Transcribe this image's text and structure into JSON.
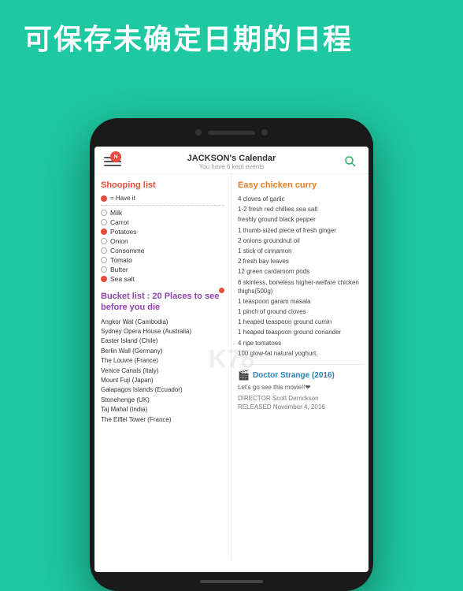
{
  "hero": {
    "text": "可保存未确定日期的日程"
  },
  "phone": {
    "header": {
      "title": "JACKSON's Calendar",
      "subtitle": "You have 6 kept events",
      "notification": "N"
    }
  },
  "left_column": {
    "shopping_section": {
      "title": "Shooping list",
      "legend": "= Have it",
      "items": [
        {
          "name": "Milk",
          "dot": "empty"
        },
        {
          "name": "Carrot",
          "dot": "empty"
        },
        {
          "name": "Potatoes",
          "dot": "red"
        },
        {
          "name": "Onion",
          "dot": "empty"
        },
        {
          "name": "Consomme",
          "dot": "empty"
        },
        {
          "name": "Tomato",
          "dot": "empty"
        },
        {
          "name": "Butter",
          "dot": "empty"
        },
        {
          "name": "Sea salt",
          "dot": "red"
        }
      ]
    },
    "bucket_section": {
      "title": "Bucket list : 20 Places to see before you die",
      "items": [
        "Angkor Wat (Cambodia)",
        "Sydney Opera House (Australia)",
        "Easter Island (Chile)",
        "Berlin Wall (Germany)",
        "The Louvre (France)",
        "Venice Canals (Italy)",
        "Mount Fuji (Japan)",
        "Galapagos Islands (Ecuador)",
        "Stonehenge (UK)",
        "Taj Mahal (India)",
        "The Eiffel Tower (France)"
      ]
    }
  },
  "right_column": {
    "curry_section": {
      "title": "Easy chicken curry",
      "ingredients": [
        "4 cloves of garlic",
        "1-2 fresh red chillies sea salt",
        "freshly ground black pepper",
        "1 thumb-sized piece of fresh ginger",
        "2 onions groundnut oil",
        "1 stick of cinnamon",
        "2 fresh bay leaves",
        "12 green cardamom pods",
        "6 skinless, boneless higher-welfare chicken thighs(500g)",
        "1 teaspoon garam masala",
        "1 pinch of ground cloves",
        "1 heaped teaspoon ground cumin",
        "1 heaped teaspoon ground coriander",
        "4 ripe tomatoes",
        "100  glow-fat natural yoghurt."
      ]
    },
    "movie_section": {
      "emoji": "🎬",
      "title": "Doctor Strange (2016)",
      "description": "Let's go see this movie!!❤",
      "director": "DIRECTOR Scott Derrickson",
      "released": "RELEASED November 4, 2016"
    }
  }
}
